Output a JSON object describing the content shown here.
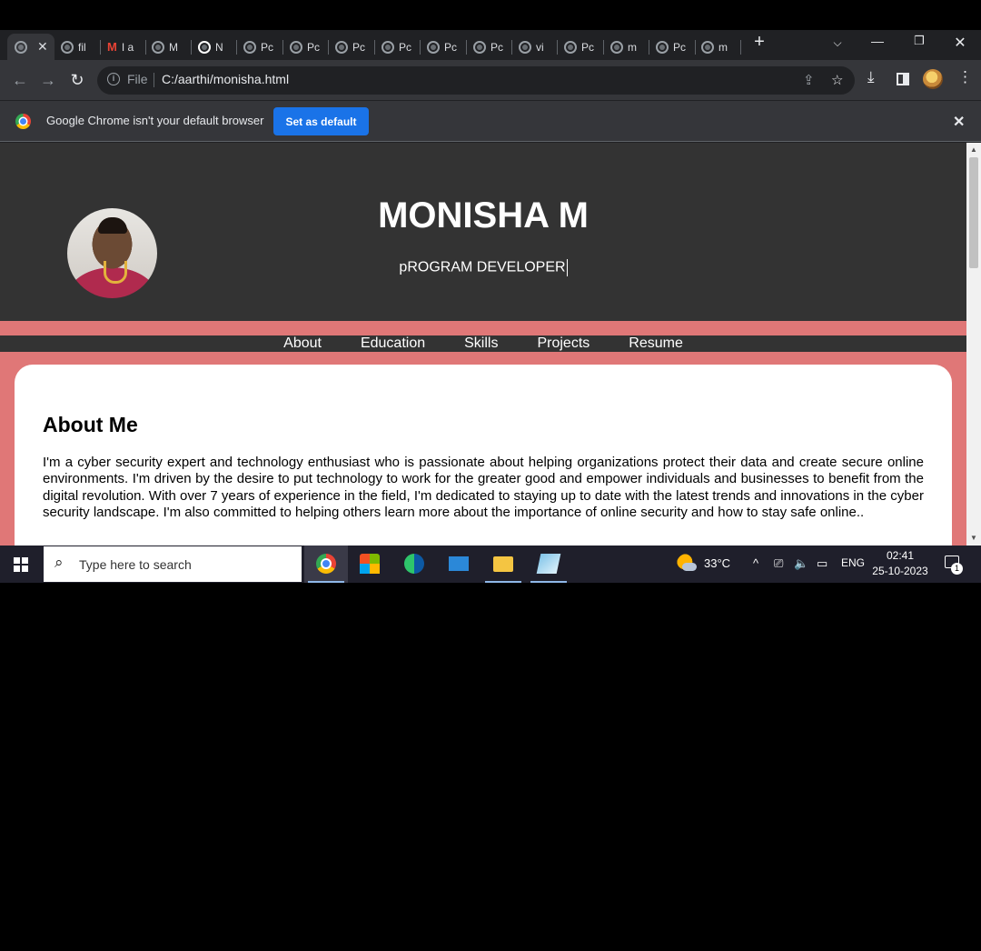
{
  "browser": {
    "tabs": [
      {
        "label": "",
        "active": true
      },
      {
        "label": "fil"
      },
      {
        "label": "I a",
        "icon": "gmail-icon"
      },
      {
        "label": "M"
      },
      {
        "label": "N",
        "icon": "chrome-icon"
      },
      {
        "label": "Pc"
      },
      {
        "label": "Pc"
      },
      {
        "label": "Pc"
      },
      {
        "label": "Pc"
      },
      {
        "label": "Pc"
      },
      {
        "label": "Pc"
      },
      {
        "label": "vi"
      },
      {
        "label": "Pc"
      },
      {
        "label": "m"
      },
      {
        "label": "Pc"
      },
      {
        "label": "m"
      }
    ],
    "omnibox": {
      "scheme_label": "File",
      "url": "C:/aarthi/monisha.html"
    },
    "infobar": {
      "message": "Google Chrome isn't your default browser",
      "button": "Set as default"
    }
  },
  "page": {
    "name": "MONISHA M",
    "role": "pROGRAM DEVELOPER",
    "nav": [
      "About",
      "Education",
      "Skills",
      "Projects",
      "Resume"
    ],
    "about": {
      "heading": "About Me",
      "body": "I'm a cyber security expert and technology enthusiast who is passionate about helping organizations protect their data and create secure online environments. I'm driven by the desire to put technology to work for the greater good and empower individuals and businesses to benefit from the digital revolution. With over 7 years of experience in the field, I'm dedicated to staying up to date with the latest trends and innovations in the cyber security landscape. I'm also committed to helping others learn more about the importance of online security and how to stay safe online.."
    }
  },
  "taskbar": {
    "search_placeholder": "Type here to search",
    "weather": "33°C",
    "language": "ENG",
    "time": "02:41",
    "date": "25-10-2023",
    "notification_count": "1"
  },
  "colors": {
    "page_accent": "#e07777",
    "header_bg": "#333333",
    "chrome_blue": "#1a73e8"
  }
}
